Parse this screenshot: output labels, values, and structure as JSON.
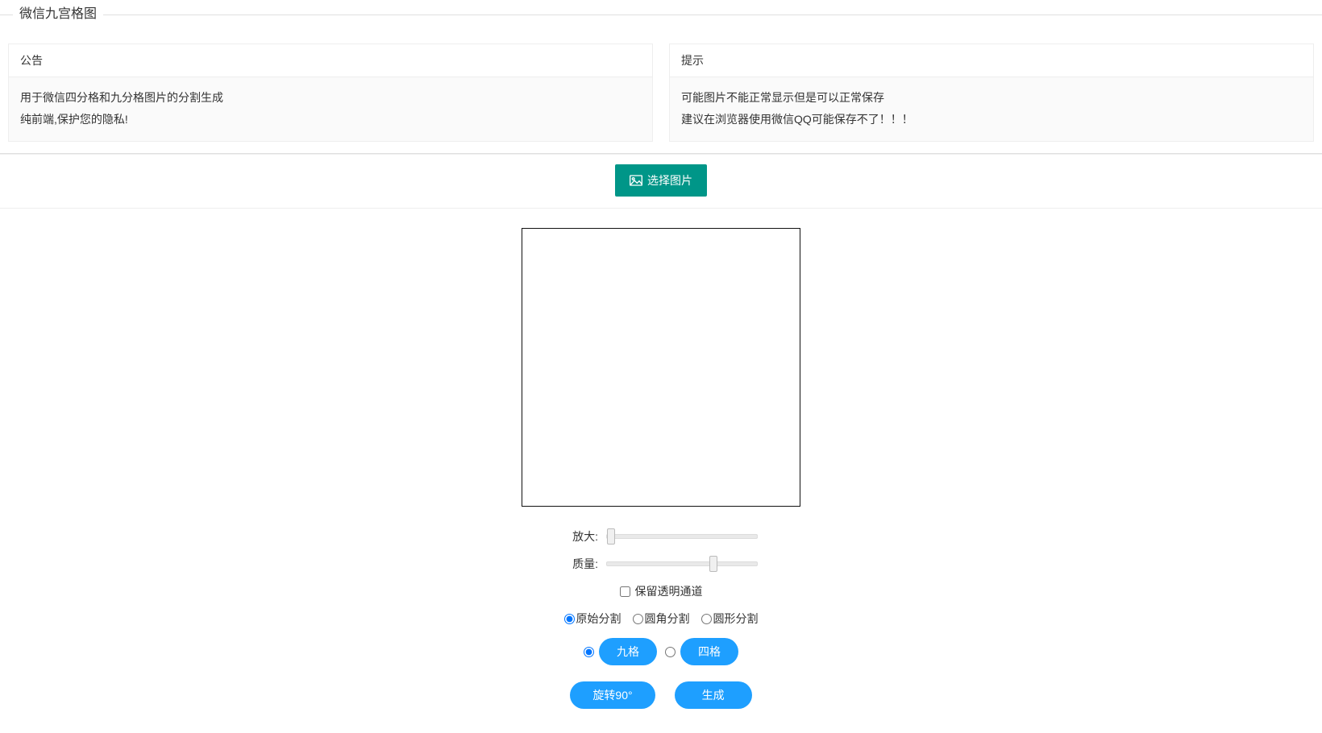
{
  "page": {
    "title": "微信九宫格图"
  },
  "cards": {
    "announcement": {
      "title": "公告",
      "line1": "用于微信四分格和九分格图片的分割生成",
      "line2": "纯前端,保护您的隐私!"
    },
    "tips": {
      "title": "提示",
      "line1": "可能图片不能正常显示但是可以正常保存",
      "line2": "建议在浏览器使用微信QQ可能保存不了！！！"
    }
  },
  "toolbar": {
    "select_image_label": "选择图片"
  },
  "controls": {
    "zoom_label": "放大:",
    "zoom_value": 0,
    "quality_label": "质量:",
    "quality_value": 72,
    "keep_alpha_label": "保留透明通道",
    "keep_alpha_checked": false,
    "split_modes": {
      "original": "原始分割",
      "rounded": "圆角分割",
      "circle": "圆形分割",
      "selected": "original"
    },
    "grid_modes": {
      "nine": "九格",
      "four": "四格",
      "selected": "nine"
    }
  },
  "actions": {
    "rotate_label": "旋转90°",
    "generate_label": "生成"
  }
}
